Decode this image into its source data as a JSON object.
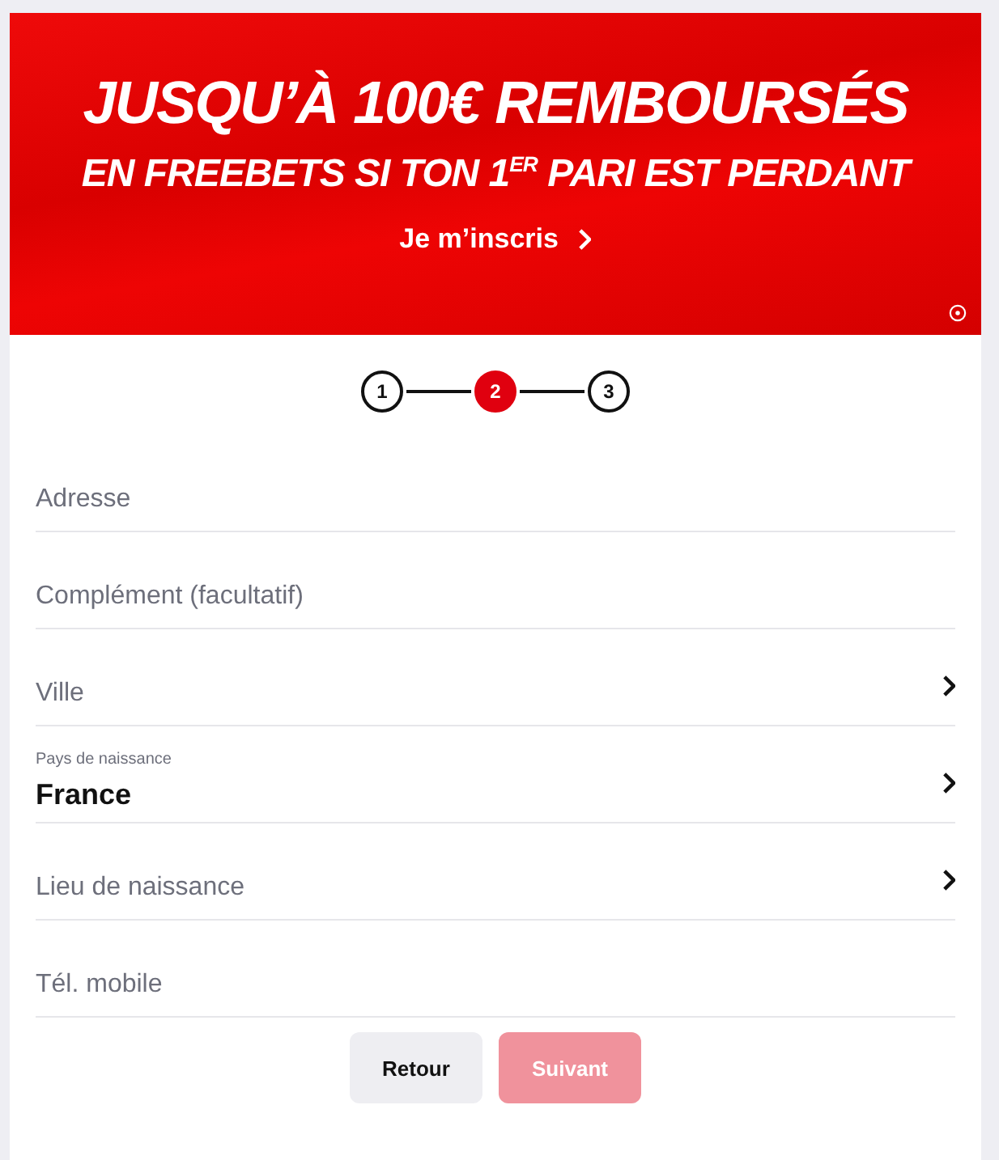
{
  "banner": {
    "headline": "JUSQU’À 100€ REMBOURSÉS",
    "subline": "EN FREEBETS SI TON 1$^{ER}$ PARI EST PERDANT",
    "cta": "Je m’inscris"
  },
  "steps": [
    {
      "label": "1",
      "selected": false
    },
    {
      "label": "2",
      "selected": true
    },
    {
      "label": "3",
      "selected": false
    }
  ],
  "fields": [
    {
      "kind": "text",
      "placeholder": "Adresse"
    },
    {
      "kind": "text",
      "placeholder": "Complément (facultatif)"
    },
    {
      "kind": "select",
      "placeholder": "Ville"
    },
    {
      "kind": "select",
      "label": "Pays de naissance",
      "value": "France"
    },
    {
      "kind": "select",
      "placeholder": "Lieu de naissance"
    },
    {
      "kind": "text",
      "placeholder": "Tél. mobile"
    }
  ],
  "buttons": [
    {
      "label": "Retour",
      "kind": "secondary",
      "disabled": false
    },
    {
      "label": "Suivant",
      "kind": "primary",
      "disabled": true
    }
  ]
}
